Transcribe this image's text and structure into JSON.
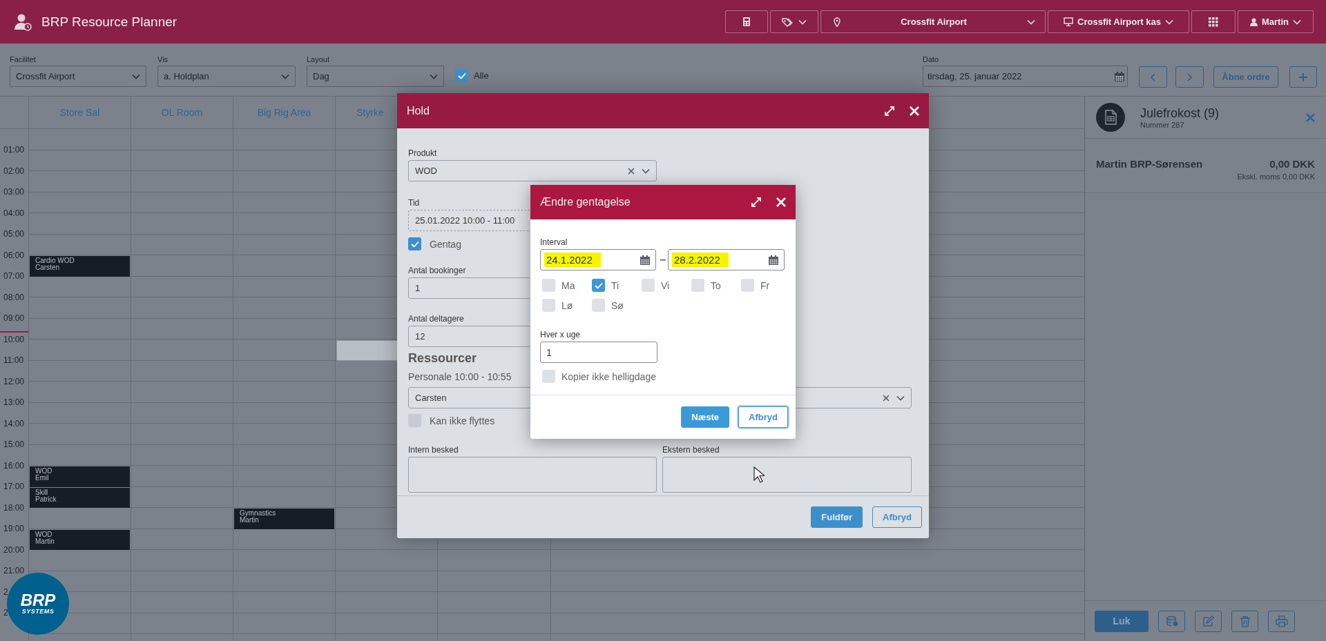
{
  "app": {
    "title": "BRP Resource Planner"
  },
  "toolbar": {
    "location": "Crossfit Airport",
    "register": "Crossfit Airport kas",
    "user": "Martin"
  },
  "filters": [
    {
      "label": "Facilitet",
      "value": "Crossfit Airport"
    },
    {
      "label": "Vis",
      "value": "a. Holdplan"
    },
    {
      "label": "Layout",
      "value": "Dag"
    }
  ],
  "show_all": {
    "label": "Alle",
    "checked": true
  },
  "date": {
    "label": "Dato",
    "value": "tirsdag, 25. januar 2022"
  },
  "open_orders_button": "Åbne ordre",
  "calendar": {
    "columns": [
      {
        "name": "Store Sal",
        "clipped": false
      },
      {
        "name": "OL Room",
        "clipped": false
      },
      {
        "name": "Big Rig Area",
        "clipped": false
      },
      {
        "name": "Styrke",
        "clipped": true
      },
      {}
    ],
    "rows": [
      {},
      {
        "time": "01:00",
        "now": false
      },
      {
        "time": "02:00",
        "now": false
      },
      {
        "time": "03:00",
        "now": false
      },
      {
        "time": "04:00",
        "now": false
      },
      {
        "time": "05:00",
        "now": false
      },
      {
        "time": "06:00",
        "now": false,
        "cells": [
          {
            "kind": "booking",
            "title": "Cardio WOD",
            "person": "Carsten"
          }
        ]
      },
      {
        "time": "07:00",
        "now": false
      },
      {
        "time": "08:00",
        "now": false
      },
      {
        "time": "09:00",
        "now": true
      },
      {
        "time": "10:00",
        "now": false,
        "cells": [
          {},
          {},
          {},
          {
            "kind": "selection"
          }
        ]
      },
      {
        "time": "11:00",
        "now": false
      },
      {
        "time": "12:00",
        "now": false
      },
      {
        "time": "13:00",
        "now": false
      },
      {
        "time": "14:00",
        "now": false
      },
      {
        "time": "15:00",
        "now": false
      },
      {
        "time": "16:00",
        "now": false,
        "cells": [
          {
            "kind": "booking",
            "title": "WOD",
            "person": "Emil"
          }
        ]
      },
      {
        "time": "17:00",
        "now": false,
        "cells": [
          {
            "kind": "booking",
            "title": "Skill",
            "person": "Patrick"
          }
        ]
      },
      {
        "time": "18:00",
        "now": false,
        "cells": [
          {},
          {},
          {
            "kind": "booking",
            "title": "Gymnastics",
            "person": "Martin"
          }
        ]
      },
      {
        "time": "19:00",
        "now": false,
        "cells": [
          {
            "kind": "booking",
            "title": "WOD",
            "person": "Martin"
          }
        ]
      },
      {
        "time": "20:00",
        "now": false
      },
      {
        "time": "21:00",
        "now": false
      },
      {
        "time": "2",
        "now": false
      },
      {
        "time": "2",
        "now": false
      }
    ]
  },
  "hold_dialog": {
    "title": "Hold",
    "product": {
      "label": "Produkt",
      "value": "WOD"
    },
    "time": {
      "label": "Tid",
      "value": "25.01.2022  10:00 - 11:00"
    },
    "repeat": {
      "label": "Gentag",
      "checked": true
    },
    "bookings": {
      "label": "Antal bookinger",
      "value": "1"
    },
    "participants": {
      "label": "Antal deltagere",
      "value": "12"
    },
    "resources_heading": "Ressourcer",
    "staff_label": "Personale 10:00 - 10:55",
    "staff": {
      "value": "Carsten"
    },
    "fixed": {
      "label": "Kan ikke flyttes",
      "checked": false
    },
    "internal_note": {
      "label": "Intern besked"
    },
    "external_note": {
      "label": "Ekstern besked"
    },
    "buttons": [
      {
        "label": "Fuldfør",
        "kind": "primary"
      },
      {
        "label": "Afbryd",
        "kind": "secondary"
      }
    ]
  },
  "recurrence_dialog": {
    "title": "Ændre gentagelse",
    "interval_label": "Interval",
    "from": {
      "value": "24.1.2022",
      "highlighted": true
    },
    "to": {
      "value": "28.2.2022",
      "highlighted": true
    },
    "days": [
      {
        "label": "Ma",
        "checked": false
      },
      {
        "label": "Ti",
        "checked": true
      },
      {
        "label": "Vi",
        "checked": false
      },
      {
        "label": "To",
        "checked": false
      },
      {
        "label": "Fr",
        "checked": false
      },
      {
        "label": "Lø",
        "checked": false
      },
      {
        "label": "Sø",
        "checked": false
      }
    ],
    "weeks": {
      "label": "Hver x uge",
      "value": "1"
    },
    "skip_holidays": {
      "label": "Kopier ikke helligdage",
      "checked": false
    },
    "buttons": [
      {
        "label": "Næste",
        "kind": "primary",
        "focused": false
      },
      {
        "label": "Afbryd",
        "kind": "secondary",
        "focused": true
      }
    ]
  },
  "order_panel": {
    "title": "Julefrokost (9)",
    "number": "Nummer 287",
    "customer": "Martin BRP-Sørensen",
    "total": "0,00 DKK",
    "excl_vat": "Ekskl. moms 0,00 DKK",
    "close_button": "Luk"
  },
  "logo": {
    "brand": "BRP",
    "sub": "SYSTEMS"
  }
}
